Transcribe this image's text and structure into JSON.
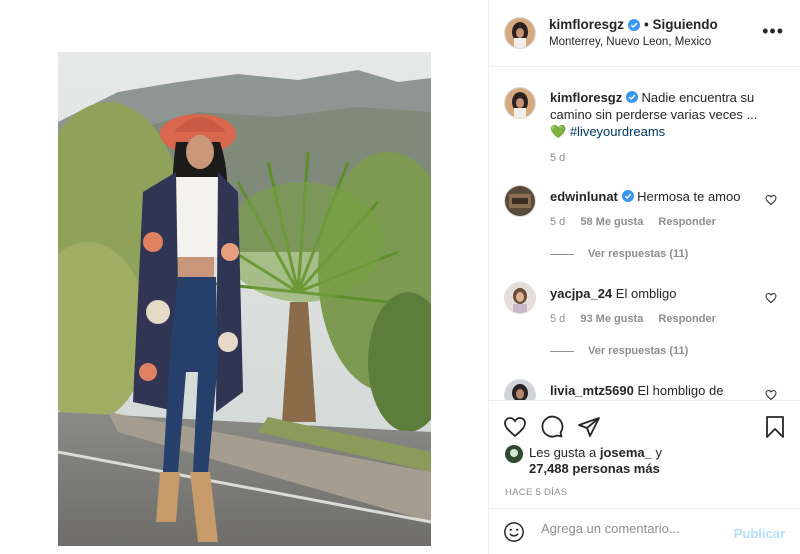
{
  "post": {
    "username": "kimfloresgz",
    "follow_status": "• Siguiendo",
    "location": "Monterrey, Nuevo Leon, Mexico",
    "more_icon": "more-dots-icon"
  },
  "caption": {
    "username": "kimfloresgz",
    "text": "Nadie encuentra su camino sin perderse varias veces ...",
    "emoji": "💚",
    "hashtag": "#liveyourdreams",
    "time": "5 d"
  },
  "comments": [
    {
      "username": "edwinlunat",
      "text": "Hermosa te amoo",
      "time": "5 d",
      "likes": "58 Me gusta",
      "reply_label": "Responder",
      "view_replies": "Ver respuestas (11)"
    },
    {
      "username": "yacjpa_24",
      "text": "El ombligo",
      "time": "5 d",
      "likes": "93 Me gusta",
      "reply_label": "Responder",
      "view_replies": "Ver respuestas (11)"
    },
    {
      "username": "livia_mtz5690",
      "text": "El hombligo de"
    }
  ],
  "likes": {
    "prefix": "Les gusta a",
    "user": "josema_",
    "conj": "y",
    "rest": "27,488 personas más"
  },
  "date": "HACE 5 DÍAS",
  "add_comment": {
    "placeholder": "Agrega un comentario...",
    "publish": "Publicar"
  },
  "colors": {
    "verified": "#3897f0",
    "link": "#00376b",
    "publish_disabled": "#b2dffc",
    "muted": "#8e8e8e"
  }
}
